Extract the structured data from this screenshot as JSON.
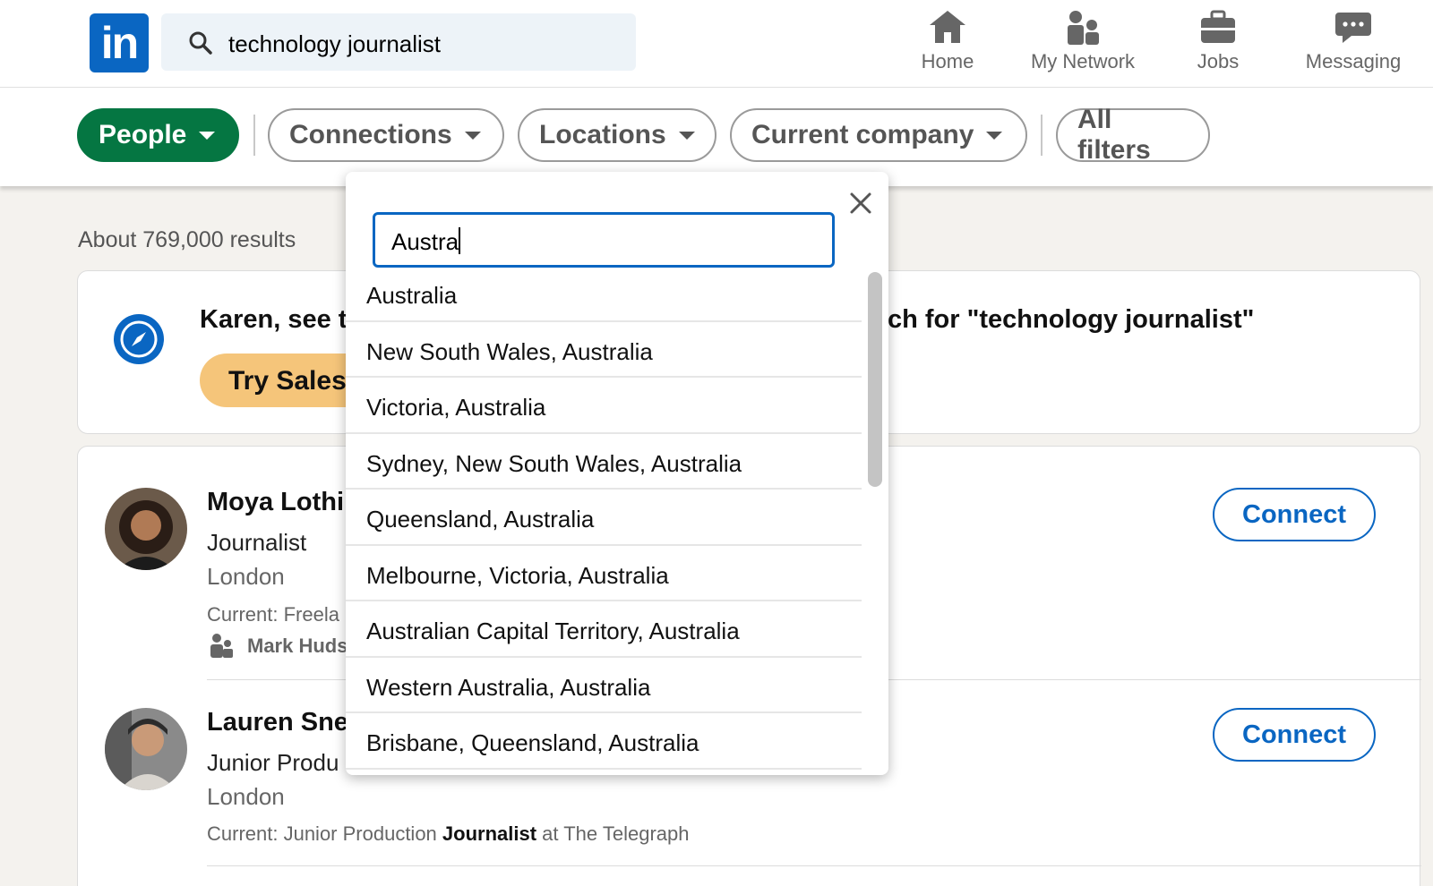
{
  "nav": {
    "logo": "in",
    "search_value": "technology journalist",
    "items": [
      "Home",
      "My Network",
      "Jobs",
      "Messaging"
    ]
  },
  "filters": {
    "people": "People",
    "connections": "Connections",
    "locations": "Locations",
    "current_company": "Current company",
    "all_filters": "All filters"
  },
  "results_count": "About 769,000 results",
  "promo": {
    "text_left": "Karen, see t",
    "text_right": "ch for \"technology journalist\"",
    "button": "Try Sales"
  },
  "people": [
    {
      "name": "Moya Lothi",
      "title": "Journalist",
      "location": "London",
      "current": "Current: Freela",
      "mutual": "Mark Huds",
      "action": "Connect"
    },
    {
      "name": "Lauren Sne",
      "title": "Junior Produ",
      "location": "London",
      "current_prefix": "Current: Junior Production ",
      "current_bold": "Journalist",
      "current_suffix": " at The Telegraph",
      "action": "Connect"
    }
  ],
  "location_dropdown": {
    "input_value": "Austra",
    "options": [
      "Australia",
      "New South Wales, Australia",
      "Victoria, Australia",
      "Sydney, New South Wales, Australia",
      "Queensland, Australia",
      "Melbourne, Victoria, Australia",
      "Australian Capital Territory, Australia",
      "Western Australia, Australia",
      "Brisbane, Queensland, Australia"
    ]
  },
  "colors": {
    "brand": "#0a66c2",
    "people_pill": "#057642",
    "try_button": "#f5c57a"
  }
}
